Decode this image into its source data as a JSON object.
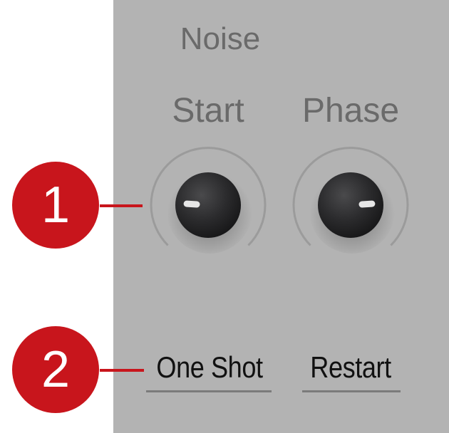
{
  "panel": {
    "title": "Noise"
  },
  "knobs": [
    {
      "label": "Start",
      "value": 0.18
    },
    {
      "label": "Phase",
      "value": 0.82
    }
  ],
  "toggles": [
    {
      "label": "One Shot"
    },
    {
      "label": "Restart"
    }
  ],
  "callouts": [
    {
      "number": "1"
    },
    {
      "number": "2"
    }
  ],
  "colors": {
    "panel_bg": "#b3b3b3",
    "label_text": "#6a6a6a",
    "toggle_text": "#111111",
    "callout_red": "#c8151c",
    "knob_body": "#2b2b2d",
    "knob_indicator": "#e6e6e6"
  }
}
